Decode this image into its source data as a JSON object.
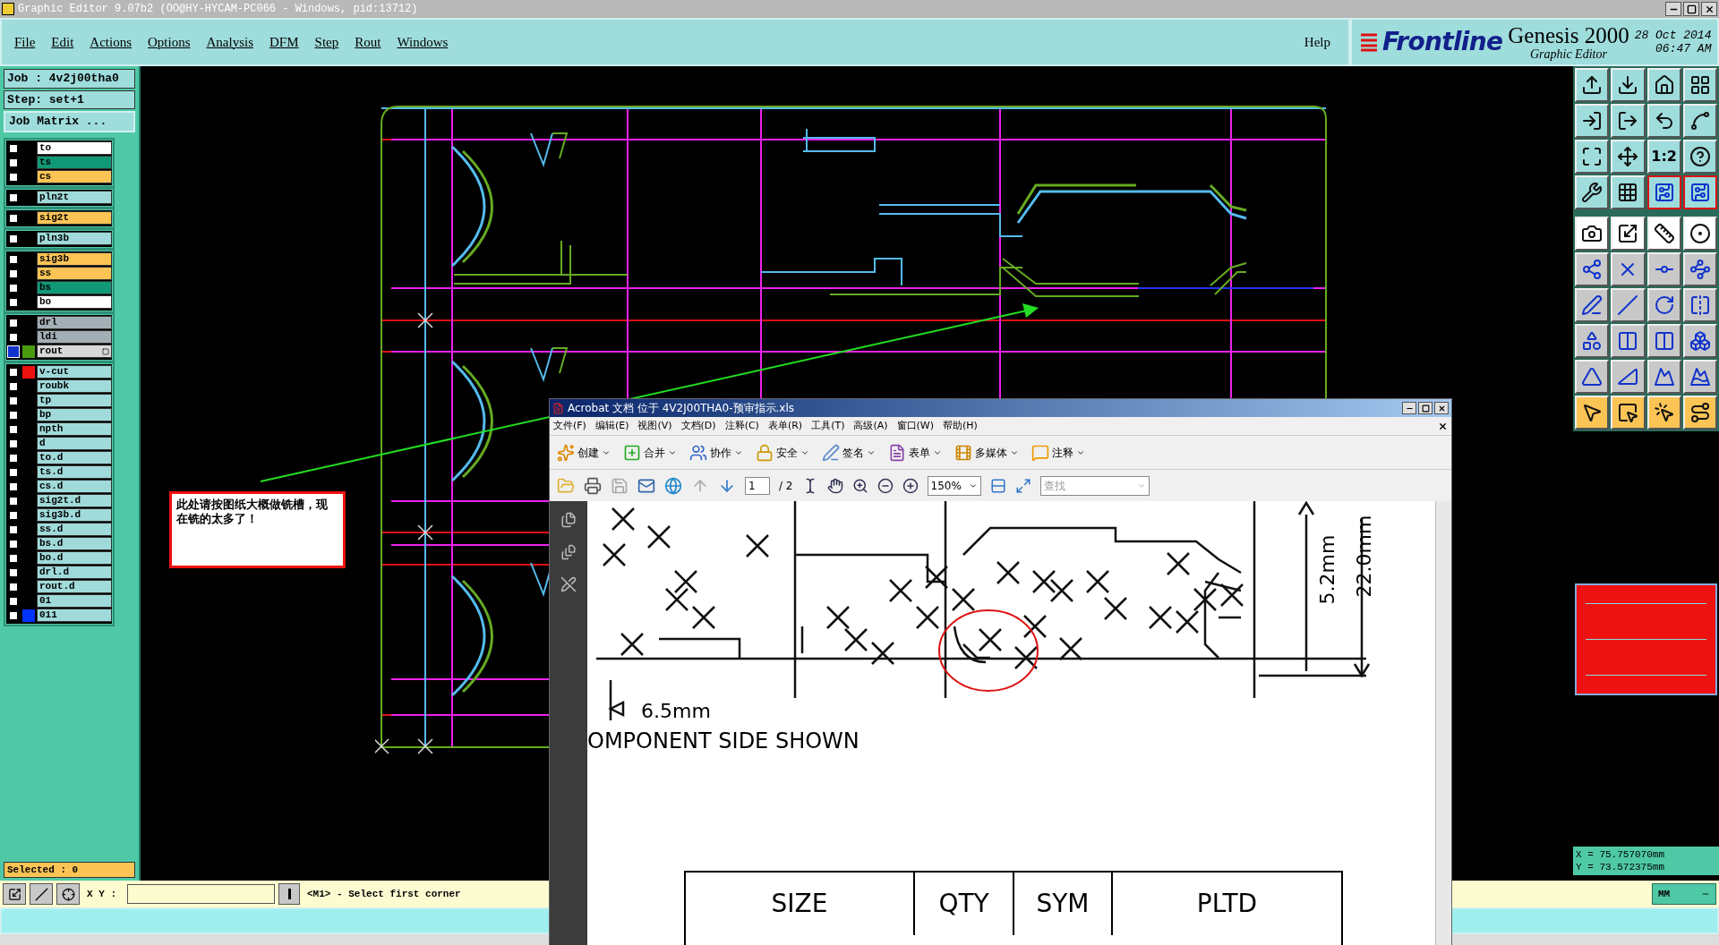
{
  "window": {
    "title": "Graphic Editor 9.07b2 (OO@HY-HYCAM-PC066 - Windows, pid:13712)"
  },
  "menu": [
    "File",
    "Edit",
    "Actions",
    "Options",
    "Analysis",
    "DFM",
    "Step",
    "Rout",
    "Windows"
  ],
  "help": "Help",
  "brand": {
    "logo": "Frontline",
    "product": "Genesis 2000",
    "subtitle": "Graphic Editor",
    "date": "28 Oct 2014",
    "time": "06:47 AM"
  },
  "job": "Job : 4v2j00tha0",
  "step": "Step: set+1",
  "job_matrix_button": "Job Matrix ...",
  "layer_groups": [
    [
      {
        "name": "to",
        "kind": "silk",
        "active": false
      },
      {
        "name": "ts",
        "kind": "mask",
        "active": false
      },
      {
        "name": "cs",
        "kind": "signal",
        "active": false
      }
    ],
    [
      {
        "name": "pln2t",
        "kind": "plane",
        "active": false
      }
    ],
    [
      {
        "name": "sig2t",
        "kind": "signal",
        "active": false
      }
    ],
    [
      {
        "name": "pln3b",
        "kind": "plane",
        "active": false
      }
    ],
    [
      {
        "name": "sig3b",
        "kind": "signal",
        "active": false
      },
      {
        "name": "ss",
        "kind": "signal",
        "active": false
      },
      {
        "name": "bs",
        "kind": "mask",
        "active": false
      },
      {
        "name": "bo",
        "kind": "silk",
        "active": false
      }
    ],
    [
      {
        "name": "drl",
        "kind": "drill",
        "active": false
      },
      {
        "name": "ldi",
        "kind": "drill",
        "active": false
      },
      {
        "name": "rout",
        "kind": "rout",
        "color": "#4a9a10",
        "active": true
      }
    ],
    [
      {
        "name": "v-cut",
        "kind": "misc",
        "color": "#ee1111",
        "active": false
      },
      {
        "name": "roubk",
        "kind": "misc",
        "active": false
      },
      {
        "name": "tp",
        "kind": "misc",
        "active": false
      },
      {
        "name": "bp",
        "kind": "misc",
        "active": false
      },
      {
        "name": "npth",
        "kind": "misc",
        "active": false
      },
      {
        "name": "d",
        "kind": "misc",
        "active": false
      },
      {
        "name": "to.d",
        "kind": "misc",
        "active": false
      },
      {
        "name": "ts.d",
        "kind": "misc",
        "active": false
      },
      {
        "name": "cs.d",
        "kind": "misc",
        "active": false
      },
      {
        "name": "sig2t.d",
        "kind": "misc",
        "active": false
      },
      {
        "name": "sig3b.d",
        "kind": "misc",
        "active": false
      },
      {
        "name": "ss.d",
        "kind": "misc",
        "active": false
      },
      {
        "name": "bs.d",
        "kind": "misc",
        "active": false
      },
      {
        "name": "bo.d",
        "kind": "misc",
        "active": false
      },
      {
        "name": "drl.d",
        "kind": "misc",
        "active": false
      },
      {
        "name": "rout.d",
        "kind": "misc",
        "active": false
      },
      {
        "name": "01",
        "kind": "misc",
        "active": false
      },
      {
        "name": "011",
        "kind": "misc",
        "color": "#0033ff",
        "active": false
      }
    ]
  ],
  "selected_count": "Selected : 0",
  "toolbar": {
    "scale_label": "1:2"
  },
  "coordinates": {
    "x": "X = 75.757070mm",
    "y": "Y = 73.572375mm"
  },
  "status": {
    "xy_label": "X Y :",
    "prompt": "<M1> - Select first corner",
    "units": "MM"
  },
  "annotation": {
    "text": "此处请按图纸大概做铣槽，现在铣的太多了！"
  },
  "acrobat": {
    "title": "Acrobat 文档 位于 4V2J00THA0-预审指示.xls",
    "menu": [
      "文件(F)",
      "编辑(E)",
      "视图(V)",
      "文档(D)",
      "注释(C)",
      "表单(R)",
      "工具(T)",
      "高级(A)",
      "窗口(W)",
      "帮助(H)"
    ],
    "tasks": [
      "创建",
      "合并",
      "协作",
      "安全",
      "签名",
      "表单",
      "多媒体",
      "注释"
    ],
    "page": "1",
    "page_count": "/ 2",
    "zoom": "150%",
    "search_placeholder": "查找",
    "drawing": {
      "dim_1": "5.2mm",
      "dim_2": "22.0mm",
      "dim_3": "6.5mm",
      "caption": "OMPONENT SIDE SHOWN"
    },
    "table_headers": [
      "SIZE",
      "QTY",
      "SYM",
      "PLTD"
    ]
  }
}
